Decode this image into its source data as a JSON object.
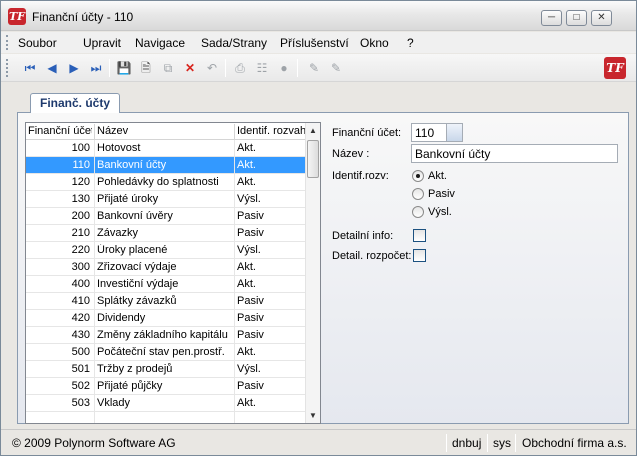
{
  "window": {
    "title": "Finanční účty - 110",
    "app_icon": "TF",
    "controls": [
      "minimize-icon",
      "maximize-icon",
      "close-icon"
    ]
  },
  "menu": {
    "items": [
      "Soubor",
      "Upravit",
      "Navigace",
      "Sada/Strany",
      "Příslušenství",
      "Okno",
      "?"
    ]
  },
  "toolbar": {
    "buttons": [
      "first-record-icon",
      "prev-record-icon",
      "next-record-icon",
      "last-record-icon",
      "save-icon",
      "new-icon",
      "copy-icon",
      "delete-icon",
      "undo-icon",
      "print-icon",
      "tree-icon",
      "lock-icon",
      "edit-icon",
      "edit-alt-icon"
    ],
    "logo": "TF"
  },
  "tab": {
    "label": "Finanč. účty"
  },
  "grid": {
    "columns": [
      "Finanční účet",
      "Název",
      "Identif. rozvah"
    ],
    "rows": [
      {
        "account": "100",
        "name": "Hotovost",
        "ident": "Akt."
      },
      {
        "account": "110",
        "name": "Bankovní účty",
        "ident": "Akt."
      },
      {
        "account": "120",
        "name": "Pohledávky do splatnosti",
        "ident": "Akt."
      },
      {
        "account": "130",
        "name": "Přijaté úroky",
        "ident": "Výsl."
      },
      {
        "account": "200",
        "name": "Bankovní úvěry",
        "ident": "Pasiv"
      },
      {
        "account": "210",
        "name": "Závazky",
        "ident": "Pasiv"
      },
      {
        "account": "220",
        "name": "Úroky placené",
        "ident": "Výsl."
      },
      {
        "account": "300",
        "name": "Zřizovací výdaje",
        "ident": "Akt."
      },
      {
        "account": "400",
        "name": "Investiční výdaje",
        "ident": "Akt."
      },
      {
        "account": "410",
        "name": "Splátky závazků",
        "ident": "Pasiv"
      },
      {
        "account": "420",
        "name": "Dividendy",
        "ident": "Pasiv"
      },
      {
        "account": "430",
        "name": "Změny základního kapitálu",
        "ident": "Pasiv"
      },
      {
        "account": "500",
        "name": "Počáteční stav pen.prostř.",
        "ident": "Akt."
      },
      {
        "account": "501",
        "name": "Tržby z prodejů",
        "ident": "Výsl."
      },
      {
        "account": "502",
        "name": "Přijaté půjčky",
        "ident": "Pasiv"
      },
      {
        "account": "503",
        "name": "Vklady",
        "ident": "Akt."
      }
    ],
    "selected_index": 1
  },
  "form": {
    "account_label": "Finanční účet:",
    "account_value": "110",
    "name_label": "Název       :",
    "name_value": "Bankovní účty",
    "ident_label": "Identif.rozv:",
    "ident_options": [
      "Akt.",
      "Pasiv",
      "Výsl."
    ],
    "ident_selected": "Akt.",
    "detail_info_label": "Detailní info:",
    "detail_info_checked": false,
    "detail_count_label": "Detail. rozpočet:",
    "detail_count_checked": false
  },
  "status": {
    "copyright": "© 2009 Polynorm Software AG",
    "user": "dnbuj",
    "role": "sys",
    "company": "Obchodní firma a.s."
  },
  "colors": {
    "selection": "#3399ff",
    "brand": "#c8262d"
  }
}
